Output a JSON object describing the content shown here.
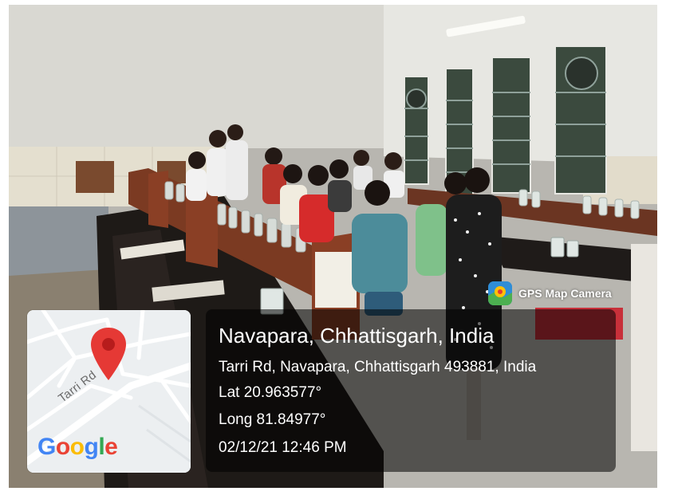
{
  "badge": {
    "app_name": "GPS Map Camera",
    "icon": "gps-map-camera-app-icon"
  },
  "map": {
    "street_label": "Tarri Rd",
    "logo": "Google",
    "pin_icon": "map-pin-icon",
    "pin_color": "#e53935"
  },
  "location": {
    "place": "Navapara, Chhattisgarh, India",
    "address": "Tarri Rd, Navapara, Chhattisgarh 493881, India",
    "latitude": "Lat 20.963577°",
    "longitude": "Long 81.84977°",
    "datetime": "02/12/21 12:46 PM"
  },
  "colors": {
    "overlay": "rgba(0,0,0,0.55)",
    "text": "#ffffff"
  }
}
